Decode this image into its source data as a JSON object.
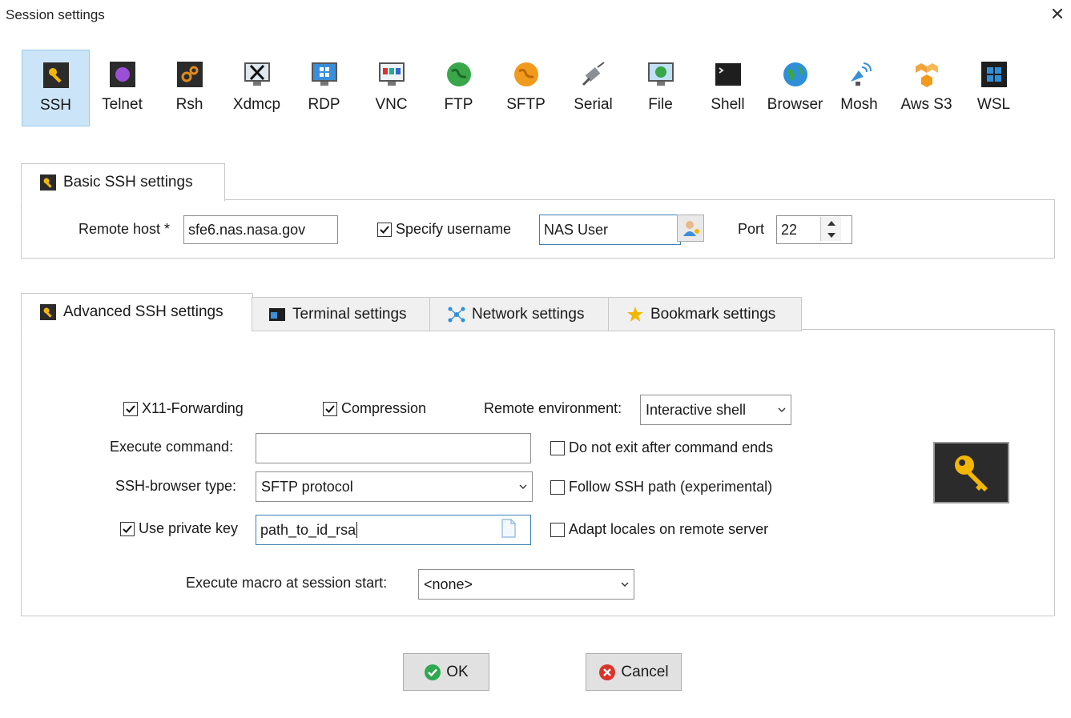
{
  "window": {
    "title": "Session settings",
    "close_glyph": "✕"
  },
  "protocols": [
    {
      "label": "SSH",
      "icon": "ssh-icon",
      "selected": true
    },
    {
      "label": "Telnet",
      "icon": "telnet-icon"
    },
    {
      "label": "Rsh",
      "icon": "rsh-icon"
    },
    {
      "label": "Xdmcp",
      "icon": "xdmcp-icon"
    },
    {
      "label": "RDP",
      "icon": "rdp-icon"
    },
    {
      "label": "VNC",
      "icon": "vnc-icon"
    },
    {
      "label": "FTP",
      "icon": "ftp-icon"
    },
    {
      "label": "SFTP",
      "icon": "sftp-icon"
    },
    {
      "label": "Serial",
      "icon": "serial-icon"
    },
    {
      "label": "File",
      "icon": "file-icon"
    },
    {
      "label": "Shell",
      "icon": "shell-icon"
    },
    {
      "label": "Browser",
      "icon": "browser-icon"
    },
    {
      "label": "Mosh",
      "icon": "mosh-icon"
    },
    {
      "label": "Aws S3",
      "icon": "aws-s3-icon"
    },
    {
      "label": "WSL",
      "icon": "wsl-icon"
    }
  ],
  "basic": {
    "tab_label": "Basic SSH settings",
    "remote_host_label": "Remote host *",
    "remote_host_value": "sfe6.nas.nasa.gov",
    "specify_username_label": "Specify username",
    "specify_username_checked": true,
    "username_value": "NAS User",
    "port_label": "Port",
    "port_value": "22"
  },
  "tabs": [
    {
      "label": "Advanced SSH settings",
      "icon": "wrench-icon",
      "active": true
    },
    {
      "label": "Terminal settings",
      "icon": "terminal-icon"
    },
    {
      "label": "Network settings",
      "icon": "network-icon"
    },
    {
      "label": "Bookmark settings",
      "icon": "star-icon"
    }
  ],
  "advanced": {
    "x11_label": "X11-Forwarding",
    "x11_checked": true,
    "compression_label": "Compression",
    "compression_checked": true,
    "remote_env_label": "Remote environment:",
    "remote_env_value": "Interactive shell",
    "exec_cmd_label": "Execute command:",
    "exec_cmd_value": "",
    "no_exit_label": "Do not exit after command ends",
    "no_exit_checked": false,
    "browser_type_label": "SSH-browser type:",
    "browser_type_value": "SFTP protocol",
    "follow_path_label": "Follow SSH path (experimental)",
    "follow_path_checked": false,
    "private_key_label": "Use private key",
    "private_key_checked": true,
    "private_key_value": "path_to_id_rsa",
    "adapt_locales_label": "Adapt locales on remote server",
    "adapt_locales_checked": false,
    "macro_label": "Execute macro at session start:",
    "macro_value": "<none>"
  },
  "buttons": {
    "ok_label": "OK",
    "cancel_label": "Cancel"
  },
  "colors": {
    "selected_bg": "#cce4f7",
    "accent": "#3c7fb1",
    "ok_green": "#2fa84f",
    "cancel_red": "#d9342b",
    "key_gold": "#f2b705"
  }
}
